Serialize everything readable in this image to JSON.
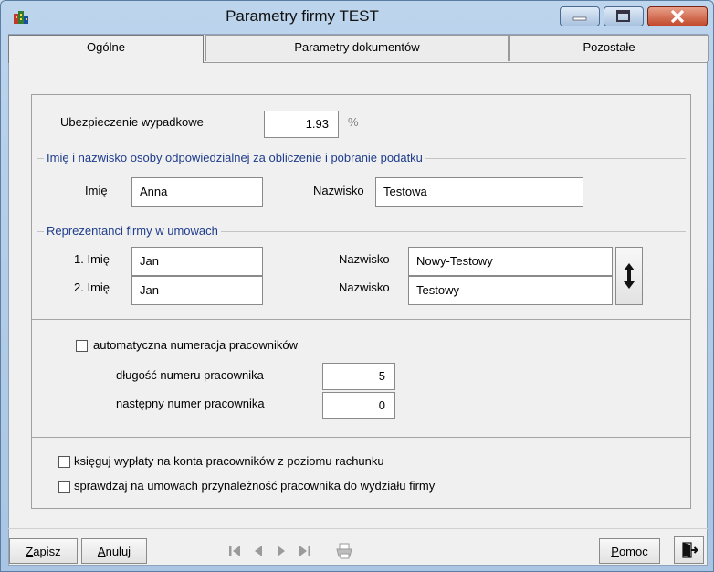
{
  "window": {
    "title": "Parametry firmy TEST"
  },
  "tabs": [
    {
      "label": "Ogólne",
      "active": true
    },
    {
      "label": "Parametry dokumentów",
      "active": false
    },
    {
      "label": "Pozostałe",
      "active": false
    }
  ],
  "insurance": {
    "label": "Ubezpieczenie wypadkowe",
    "value": "1.93",
    "unit": "%"
  },
  "responsible": {
    "group_label": "Imię i nazwisko osoby odpowiedzialnej za obliczenie i pobranie podatku",
    "first_name_label": "Imię",
    "first_name": "Anna",
    "last_name_label": "Nazwisko",
    "last_name": "Testowa"
  },
  "representatives": {
    "group_label": "Reprezentanci firmy w umowach",
    "rows": [
      {
        "first_label": "1. Imię",
        "first": "Jan",
        "last_label": "Nazwisko",
        "last": "Nowy-Testowy"
      },
      {
        "first_label": "2. Imię",
        "first": "Jan",
        "last_label": "Nazwisko",
        "last": "Testowy"
      }
    ]
  },
  "numbering": {
    "auto_label": "automatyczna numeracja pracowników",
    "auto_checked": false,
    "length_label": "długość numeru pracownika",
    "length_value": "5",
    "next_label": "następny numer pracownika",
    "next_value": "0"
  },
  "options": {
    "post_label": "księguj wypłaty na konta pracowników z poziomu rachunku",
    "post_checked": false,
    "check_label": "sprawdzaj na umowach przynależność pracownika do wydziału firmy",
    "check_checked": false
  },
  "footer": {
    "save_hot": "Z",
    "save_rest": "apisz",
    "cancel_hot": "A",
    "cancel_rest": "nuluj",
    "help_hot": "P",
    "help_rest": "omoc"
  },
  "colors": {
    "titlebar": "#b3cce8",
    "group_label": "#1f3d8c",
    "close": "#c24a2c"
  }
}
